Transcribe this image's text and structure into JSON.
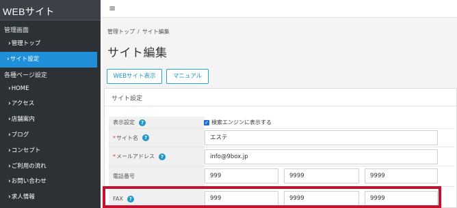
{
  "sidebar": {
    "brand": "WEBサイト",
    "section_admin": "管理画面",
    "admin_items": [
      {
        "label": "管理トップ",
        "active": false
      },
      {
        "label": "サイト設定",
        "active": true
      }
    ],
    "section_pages": "各種ページ設定",
    "page_items": [
      {
        "label": "HOME"
      },
      {
        "label": "アクセス"
      },
      {
        "label": "店舗案内"
      },
      {
        "label": "ブログ"
      },
      {
        "label": "コンセプト"
      },
      {
        "label": "ご利用の流れ"
      },
      {
        "label": "お問い合わせ"
      },
      {
        "label": "求人情報"
      }
    ]
  },
  "header": {
    "menu_icon": "hamburger-icon"
  },
  "breadcrumb": {
    "home": "管理トップ",
    "separator": "/",
    "current": "サイト編集"
  },
  "page_title": "サイト編集",
  "buttons": {
    "web_view": "WEBサイト表示",
    "manual": "マニュアル"
  },
  "card": {
    "title": "サイト設定",
    "fields": {
      "display": {
        "label": "表示設定",
        "checkbox_label": "検索エンジンに表示する",
        "checked": true
      },
      "site_name": {
        "label": "サイト名",
        "required": true,
        "value": "エステ"
      },
      "email": {
        "label": "メールアドレス",
        "required": true,
        "value": "info@9box.jp"
      },
      "phone": {
        "label": "電話番号",
        "values": [
          "999",
          "9999",
          "9999"
        ]
      },
      "fax": {
        "label": "FAX",
        "values": [
          "999",
          "9999",
          "9999"
        ]
      }
    }
  },
  "colors": {
    "sidebar_bg": "#2c3136",
    "active": "#1e8fd8",
    "accent": "#27a3c9",
    "highlight": "#c8102e"
  }
}
